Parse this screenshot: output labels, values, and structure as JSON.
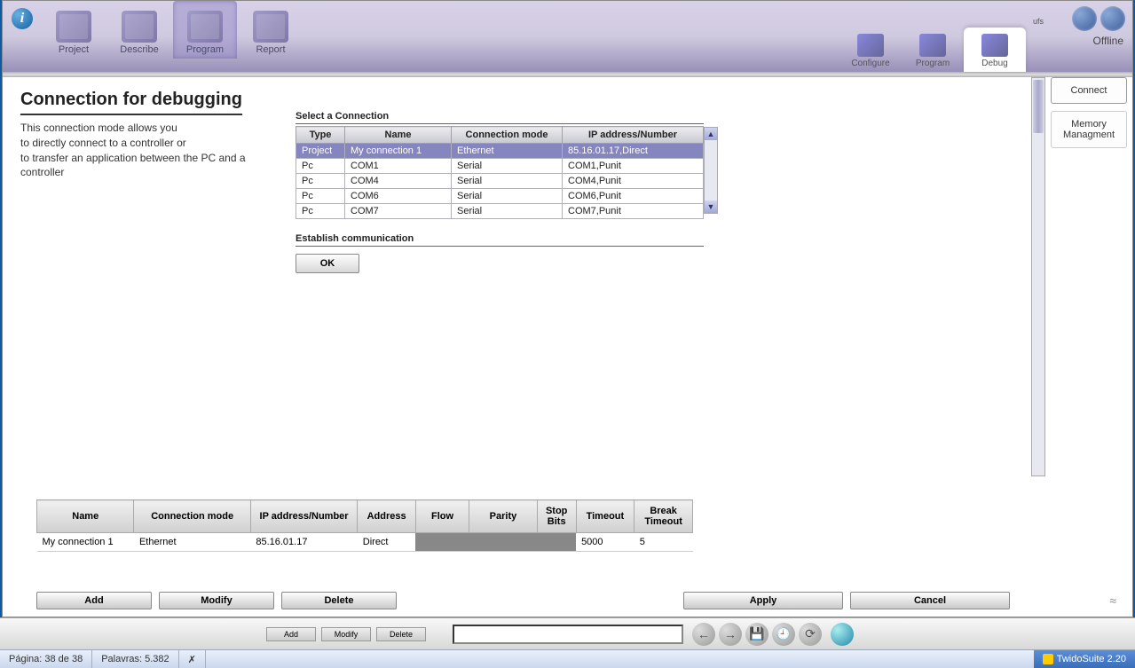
{
  "main_tabs": {
    "project": "Project",
    "describe": "Describe",
    "program": "Program",
    "report": "Report"
  },
  "right_tabs": {
    "configure": "Configure",
    "program": "Program",
    "debug": "Debug"
  },
  "ufs": "ufs",
  "offline": "Offline",
  "side": {
    "connect": "Connect",
    "memory": "Memory Managment"
  },
  "page": {
    "title": "Connection for debugging",
    "desc1": "This connection mode allows you",
    "desc2": " to directly connect to a controller or",
    "desc3": " to transfer an application between the PC and a",
    "desc4": "controller"
  },
  "section": {
    "select": "Select a Connection",
    "establish": "Establish communication"
  },
  "conn_headers": {
    "type": "Type",
    "name": "Name",
    "mode": "Connection mode",
    "ip": "IP address/Number"
  },
  "conn_rows": [
    {
      "type": "Project",
      "name": "My connection 1",
      "mode": "Ethernet",
      "ip": "85.16.01.17,Direct",
      "sel": true
    },
    {
      "type": "Pc",
      "name": "COM1",
      "mode": "Serial",
      "ip": "COM1,Punit"
    },
    {
      "type": "Pc",
      "name": "COM4",
      "mode": "Serial",
      "ip": "COM4,Punit"
    },
    {
      "type": "Pc",
      "name": "COM6",
      "mode": "Serial",
      "ip": "COM6,Punit"
    },
    {
      "type": "Pc",
      "name": "COM7",
      "mode": "Serial",
      "ip": "COM7,Punit"
    }
  ],
  "ok": "OK",
  "detail_headers": {
    "name": "Name",
    "mode": "Connection mode",
    "ip": "IP address/Number",
    "address": "Address",
    "flow": "Flow",
    "parity": "Parity",
    "stop": "Stop Bits",
    "timeout": "Timeout",
    "break": "Break Timeout"
  },
  "detail_row": {
    "name": "My connection 1",
    "mode": "Ethernet",
    "ip": "85.16.01.17",
    "address": "Direct",
    "flow": "",
    "parity": "",
    "stop": "",
    "timeout": "5000",
    "break": "5"
  },
  "buttons": {
    "add": "Add",
    "modify": "Modify",
    "delete": "Delete",
    "apply": "Apply",
    "cancel": "Cancel"
  },
  "mini_buttons": {
    "add": "Add",
    "modify": "Modify",
    "delete": "Delete"
  },
  "status": {
    "page": "Página: 38 de 38",
    "words": "Palavras: 5.382",
    "tray": "TwidoSuite 2.20"
  }
}
